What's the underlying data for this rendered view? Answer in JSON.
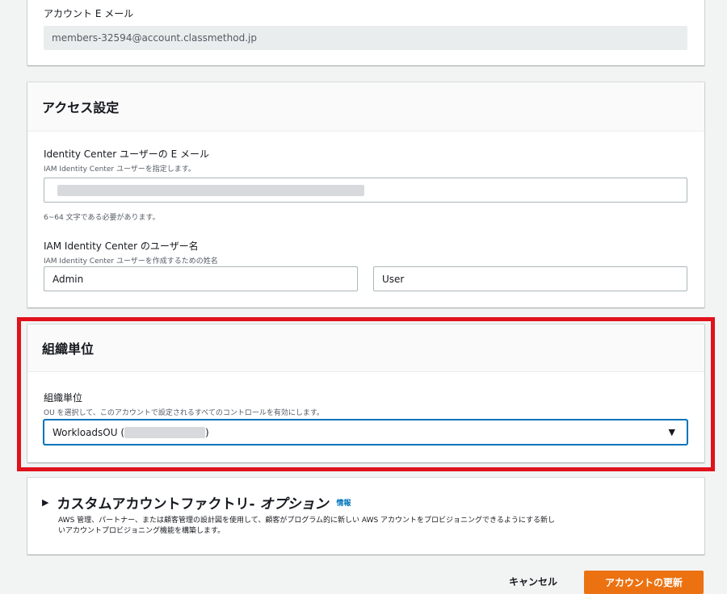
{
  "account_email_panel": {
    "label": "アカウント E メール",
    "value": "members-32594@account.classmethod.jp"
  },
  "access_panel": {
    "title": "アクセス設定",
    "email_label": "Identity Center ユーザーの E メール",
    "email_sublabel": "IAM Identity Center ユーザーを指定します。",
    "email_hint": "6~64 文字である必要があります。",
    "name_label": "IAM Identity Center のユーザー名",
    "name_sublabel": "IAM Identity Center ユーザーを作成するための姓名",
    "first_name": "Admin",
    "last_name": "User"
  },
  "ou_panel": {
    "title": "組織単位",
    "label": "組織単位",
    "sublabel": "OU を選択して、このアカウントで設定されるすべてのコントロールを有効にします。",
    "selected_prefix": "WorkloadsOU (",
    "selected_suffix": ")",
    "dropdown_icon": "▼",
    "highlight_color": "#e0121b"
  },
  "custom_factory": {
    "expand_icon": "▶",
    "title": "カスタムアカウントファクトリ- ",
    "title_italic": "オプション",
    "info_link": "情報",
    "description_line1": "AWS 管理、パートナー、または顧客管理の設計図を使用して、顧客がプログラム的に新しい AWS アカウントをプロビジョニングできるようにする新し",
    "description_line2": "いアカウントプロビジョニング機能を構築します。"
  },
  "footer": {
    "cancel_label": "キャンセル",
    "update_label": "アカウントの更新",
    "primary_color": "#ec7211"
  }
}
